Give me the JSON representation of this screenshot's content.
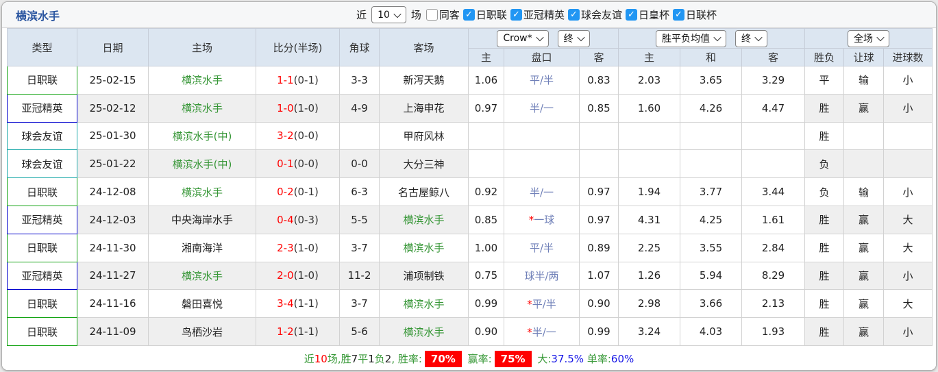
{
  "title": "横滨水手",
  "filters": {
    "recent_label": "近",
    "recent_value": "10",
    "matches_label": "场",
    "checkboxes": [
      {
        "label": "同客",
        "checked": false
      },
      {
        "label": "日职联",
        "checked": true
      },
      {
        "label": "亚冠精英",
        "checked": true
      },
      {
        "label": "球会友谊",
        "checked": true
      },
      {
        "label": "日皇杯",
        "checked": true
      },
      {
        "label": "日联杯",
        "checked": true
      }
    ]
  },
  "table": {
    "main_headers": [
      "类型",
      "日期",
      "主场",
      "比分(半场)",
      "角球",
      "客场"
    ],
    "selects": {
      "company": "Crow*",
      "company_time": "终",
      "avg": "胜平负均值",
      "avg_time": "终",
      "scope": "全场"
    },
    "sub_headers": [
      "主",
      "盘口",
      "客",
      "主",
      "和",
      "客",
      "胜负",
      "让球",
      "进球数"
    ],
    "rows": [
      {
        "type": "日职联",
        "type_c": "green",
        "date": "25-02-15",
        "home": "横滨水手",
        "home_self": true,
        "score": "1-1",
        "half": "(0-1)",
        "corner": "3-3",
        "away": "新泻天鹅",
        "away_self": false,
        "odds_home": "1.06",
        "handicap_star": "",
        "handicap": "平/半",
        "odds_away": "0.83",
        "avg_home": "2.03",
        "avg_draw": "3.65",
        "avg_away": "3.29",
        "result": "平",
        "result_c": "blue",
        "handicap_result": "输",
        "hr_c": "green",
        "goals": "小",
        "goals_c": "green"
      },
      {
        "type": "亚冠精英",
        "type_c": "blue",
        "date": "25-02-12",
        "home": "横滨水手",
        "home_self": true,
        "score": "1-0",
        "half": "(1-0)",
        "corner": "4-9",
        "away": "上海申花",
        "away_self": false,
        "odds_home": "0.97",
        "handicap_star": "",
        "handicap": "半/一",
        "odds_away": "0.85",
        "avg_home": "1.60",
        "avg_draw": "4.26",
        "avg_away": "4.47",
        "result": "胜",
        "result_c": "red",
        "handicap_result": "赢",
        "hr_c": "red",
        "goals": "小",
        "goals_c": "green"
      },
      {
        "type": "球会友谊",
        "type_c": "teal",
        "date": "25-01-30",
        "home": "横滨水手(中)",
        "home_self": true,
        "score": "3-2",
        "half": "(0-0)",
        "corner": "",
        "away": "甲府风林",
        "away_self": false,
        "odds_home": "",
        "handicap_star": "",
        "handicap": "",
        "odds_away": "",
        "avg_home": "",
        "avg_draw": "",
        "avg_away": "",
        "result": "胜",
        "result_c": "red",
        "handicap_result": "",
        "hr_c": "",
        "goals": "",
        "goals_c": ""
      },
      {
        "type": "球会友谊",
        "type_c": "teal",
        "date": "25-01-22",
        "home": "横滨水手(中)",
        "home_self": true,
        "score": "0-1",
        "half": "(0-0)",
        "corner": "0-0",
        "away": "大分三神",
        "away_self": false,
        "odds_home": "",
        "handicap_star": "",
        "handicap": "",
        "odds_away": "",
        "avg_home": "",
        "avg_draw": "",
        "avg_away": "",
        "result": "负",
        "result_c": "green",
        "handicap_result": "",
        "hr_c": "",
        "goals": "",
        "goals_c": ""
      },
      {
        "type": "日职联",
        "type_c": "green",
        "date": "24-12-08",
        "home": "横滨水手",
        "home_self": true,
        "score": "0-2",
        "half": "(0-1)",
        "corner": "6-3",
        "away": "名古屋鲸八",
        "away_self": false,
        "odds_home": "0.92",
        "handicap_star": "",
        "handicap": "半/一",
        "odds_away": "0.97",
        "avg_home": "1.94",
        "avg_draw": "3.77",
        "avg_away": "3.44",
        "result": "负",
        "result_c": "green",
        "handicap_result": "输",
        "hr_c": "green",
        "goals": "小",
        "goals_c": "green"
      },
      {
        "type": "亚冠精英",
        "type_c": "blue",
        "date": "24-12-03",
        "home": "中央海岸水手",
        "home_self": false,
        "score": "0-4",
        "half": "(0-3)",
        "corner": "5-5",
        "away": "横滨水手",
        "away_self": true,
        "odds_home": "0.85",
        "handicap_star": "*",
        "handicap": "一球",
        "odds_away": "0.97",
        "avg_home": "4.31",
        "avg_draw": "4.25",
        "avg_away": "1.61",
        "result": "胜",
        "result_c": "red",
        "handicap_result": "赢",
        "hr_c": "red",
        "goals": "大",
        "goals_c": "red"
      },
      {
        "type": "日职联",
        "type_c": "green",
        "date": "24-11-30",
        "home": "湘南海洋",
        "home_self": false,
        "score": "2-3",
        "half": "(1-0)",
        "corner": "3-7",
        "away": "横滨水手",
        "away_self": true,
        "odds_home": "1.00",
        "handicap_star": "",
        "handicap": "平/半",
        "odds_away": "0.89",
        "avg_home": "2.25",
        "avg_draw": "3.55",
        "avg_away": "2.84",
        "result": "胜",
        "result_c": "red",
        "handicap_result": "赢",
        "hr_c": "red",
        "goals": "大",
        "goals_c": "red"
      },
      {
        "type": "亚冠精英",
        "type_c": "blue",
        "date": "24-11-27",
        "home": "横滨水手",
        "home_self": true,
        "score": "2-0",
        "half": "(1-0)",
        "corner": "11-2",
        "away": "浦项制铁",
        "away_self": false,
        "odds_home": "0.75",
        "handicap_star": "",
        "handicap": "球半/两",
        "odds_away": "1.07",
        "avg_home": "1.26",
        "avg_draw": "5.94",
        "avg_away": "8.29",
        "result": "胜",
        "result_c": "red",
        "handicap_result": "赢",
        "hr_c": "red",
        "goals": "小",
        "goals_c": "green"
      },
      {
        "type": "日职联",
        "type_c": "green",
        "date": "24-11-16",
        "home": "磐田喜悦",
        "home_self": false,
        "score": "3-4",
        "half": "(1-1)",
        "corner": "3-7",
        "away": "横滨水手",
        "away_self": true,
        "odds_home": "0.99",
        "handicap_star": "*",
        "handicap": "平/半",
        "odds_away": "0.90",
        "avg_home": "2.98",
        "avg_draw": "3.66",
        "avg_away": "2.13",
        "result": "胜",
        "result_c": "red",
        "handicap_result": "赢",
        "hr_c": "red",
        "goals": "大",
        "goals_c": "red"
      },
      {
        "type": "日职联",
        "type_c": "green",
        "date": "24-11-09",
        "home": "鸟栖沙岩",
        "home_self": false,
        "score": "1-2",
        "half": "(1-1)",
        "corner": "5-6",
        "away": "横滨水手",
        "away_self": true,
        "odds_home": "0.90",
        "handicap_star": "*",
        "handicap": "半/一",
        "odds_away": "0.99",
        "avg_home": "3.24",
        "avg_draw": "4.03",
        "avg_away": "1.93",
        "result": "胜",
        "result_c": "red",
        "handicap_result": "赢",
        "hr_c": "red",
        "goals": "小",
        "goals_c": "green"
      }
    ]
  },
  "footer": {
    "tokens": [
      {
        "t": "近",
        "c": "green"
      },
      {
        "t": "10",
        "c": "red"
      },
      {
        "t": "场,胜",
        "c": "green"
      },
      {
        "t": "7",
        "c": "dark"
      },
      {
        "t": "平",
        "c": "green"
      },
      {
        "t": "1",
        "c": "dark"
      },
      {
        "t": "负",
        "c": "green"
      },
      {
        "t": "2",
        "c": "dark"
      },
      {
        "t": ", 胜率:",
        "c": "green"
      },
      {
        "t": "70%",
        "c": "badge"
      },
      {
        "t": " 赢率:",
        "c": "green"
      },
      {
        "t": "75%",
        "c": "badge"
      },
      {
        "t": " 大:",
        "c": "green"
      },
      {
        "t": "37.5%",
        "c": "blue"
      },
      {
        "t": " 单率:",
        "c": "green"
      },
      {
        "t": "60%",
        "c": "blue"
      }
    ]
  },
  "colors": {
    "league_jleague": "#12a312",
    "league_acl": "#0000cd",
    "league_friendly": "#1ca9a9",
    "score_red": "#ff0000",
    "team_green": "#369636",
    "badge_red": "#ff0000",
    "checkbox_blue": "#2196f3",
    "header_bg": "#dce6f1",
    "odds_col_bg": "#faf6ed",
    "avg_col_bg": "#e9f4fa"
  }
}
